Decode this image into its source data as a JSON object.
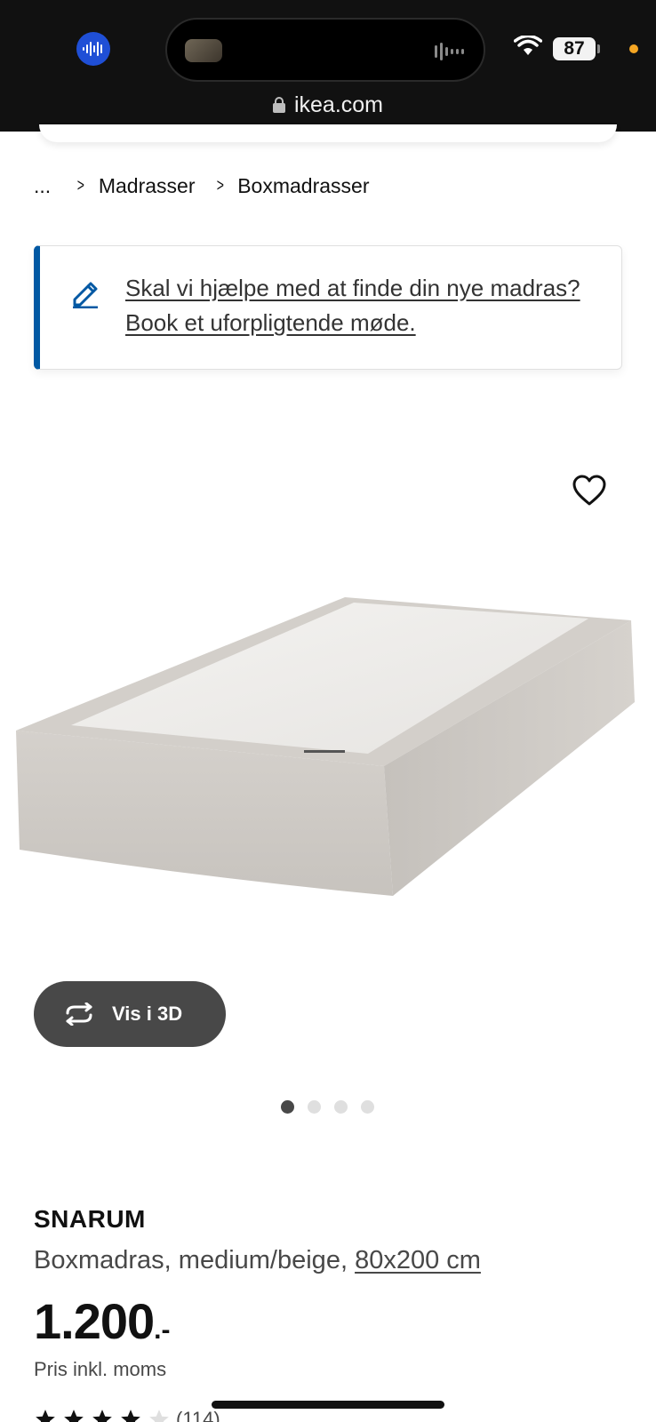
{
  "status_bar": {
    "battery_level": "87",
    "url": "ikea.com",
    "accent_colors": {
      "audio_indicator": "#1f4fd6",
      "privacy_dot": "#f5a623"
    }
  },
  "breadcrumb": {
    "items": [
      "...",
      "Madrasser",
      "Boxmadrasser"
    ]
  },
  "banner": {
    "link_text": "Skal vi hjælpe med at finde din nye madras? Book et uforpligtende møde.",
    "accent_color": "#0058a3",
    "icon": "pencil-icon"
  },
  "product": {
    "name": "SNARUM",
    "description": "Boxmadras, medium/beige, ",
    "size_link": "80x200 cm",
    "price": "1.200",
    "price_suffix": ".-",
    "price_note": "Pris inkl. moms",
    "view_3d_label": "Vis i 3D",
    "image_count": 4,
    "active_image": 1,
    "rating": {
      "stars": 4,
      "count_text": "(114)"
    }
  }
}
